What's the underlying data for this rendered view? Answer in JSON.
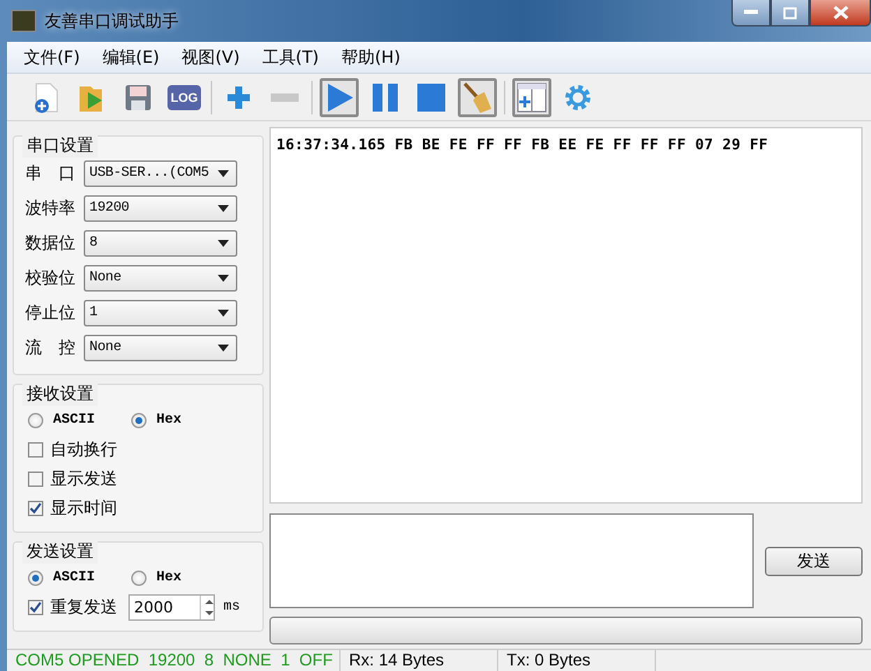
{
  "window": {
    "title": "友善串口调试助手"
  },
  "menu": [
    "文件(F)",
    "编辑(E)",
    "视图(V)",
    "工具(T)",
    "帮助(H)"
  ],
  "toolbar": [
    {
      "kind": "new",
      "pressed": false
    },
    {
      "kind": "open",
      "pressed": false
    },
    {
      "kind": "save",
      "pressed": false
    },
    {
      "kind": "log",
      "label": "LOG",
      "pressed": false
    },
    {
      "kind": "sep"
    },
    {
      "kind": "plus",
      "pressed": false
    },
    {
      "kind": "minus",
      "pressed": false
    },
    {
      "kind": "sep"
    },
    {
      "kind": "play",
      "pressed": true
    },
    {
      "kind": "pause",
      "pressed": false
    },
    {
      "kind": "stop",
      "pressed": false
    },
    {
      "kind": "clear",
      "pressed": true
    },
    {
      "kind": "sep"
    },
    {
      "kind": "window",
      "pressed": true
    },
    {
      "kind": "gear",
      "pressed": false
    }
  ],
  "serial_settings": {
    "title": "串口设置",
    "fields": [
      {
        "label": "串 口",
        "value": "USB-SER...(COM5"
      },
      {
        "label": "波特率",
        "value": "19200"
      },
      {
        "label": "数据位",
        "value": "8"
      },
      {
        "label": "校验位",
        "value": "None"
      },
      {
        "label": "停止位",
        "value": "1"
      },
      {
        "label": "流 控",
        "value": "None"
      }
    ]
  },
  "receive_settings": {
    "title": "接收设置",
    "modes": [
      {
        "label": "ASCII",
        "selected": false
      },
      {
        "label": "Hex",
        "selected": true
      }
    ],
    "options": [
      {
        "label": "自动换行",
        "checked": false
      },
      {
        "label": "显示发送",
        "checked": false
      },
      {
        "label": "显示时间",
        "checked": true
      }
    ]
  },
  "send_settings": {
    "title": "发送设置",
    "modes": [
      {
        "label": "ASCII",
        "selected": true
      },
      {
        "label": "Hex",
        "selected": false
      }
    ],
    "repeat": {
      "label": "重复发送",
      "checked": true,
      "value": "2000",
      "unit": "ms"
    }
  },
  "receive_area": {
    "lines": [
      "16:37:34.165 FB BE FE FF FF FB EE FE FF FF FF 07 29 FF"
    ]
  },
  "send_button": "发送",
  "status_bar": [
    {
      "kind": "port",
      "text": "COM5 OPENED  19200  8  NONE  1  OFF"
    },
    {
      "kind": "counter",
      "text": "Rx: 14 Bytes"
    },
    {
      "kind": "counter",
      "text": "Tx: 0 Bytes"
    }
  ]
}
